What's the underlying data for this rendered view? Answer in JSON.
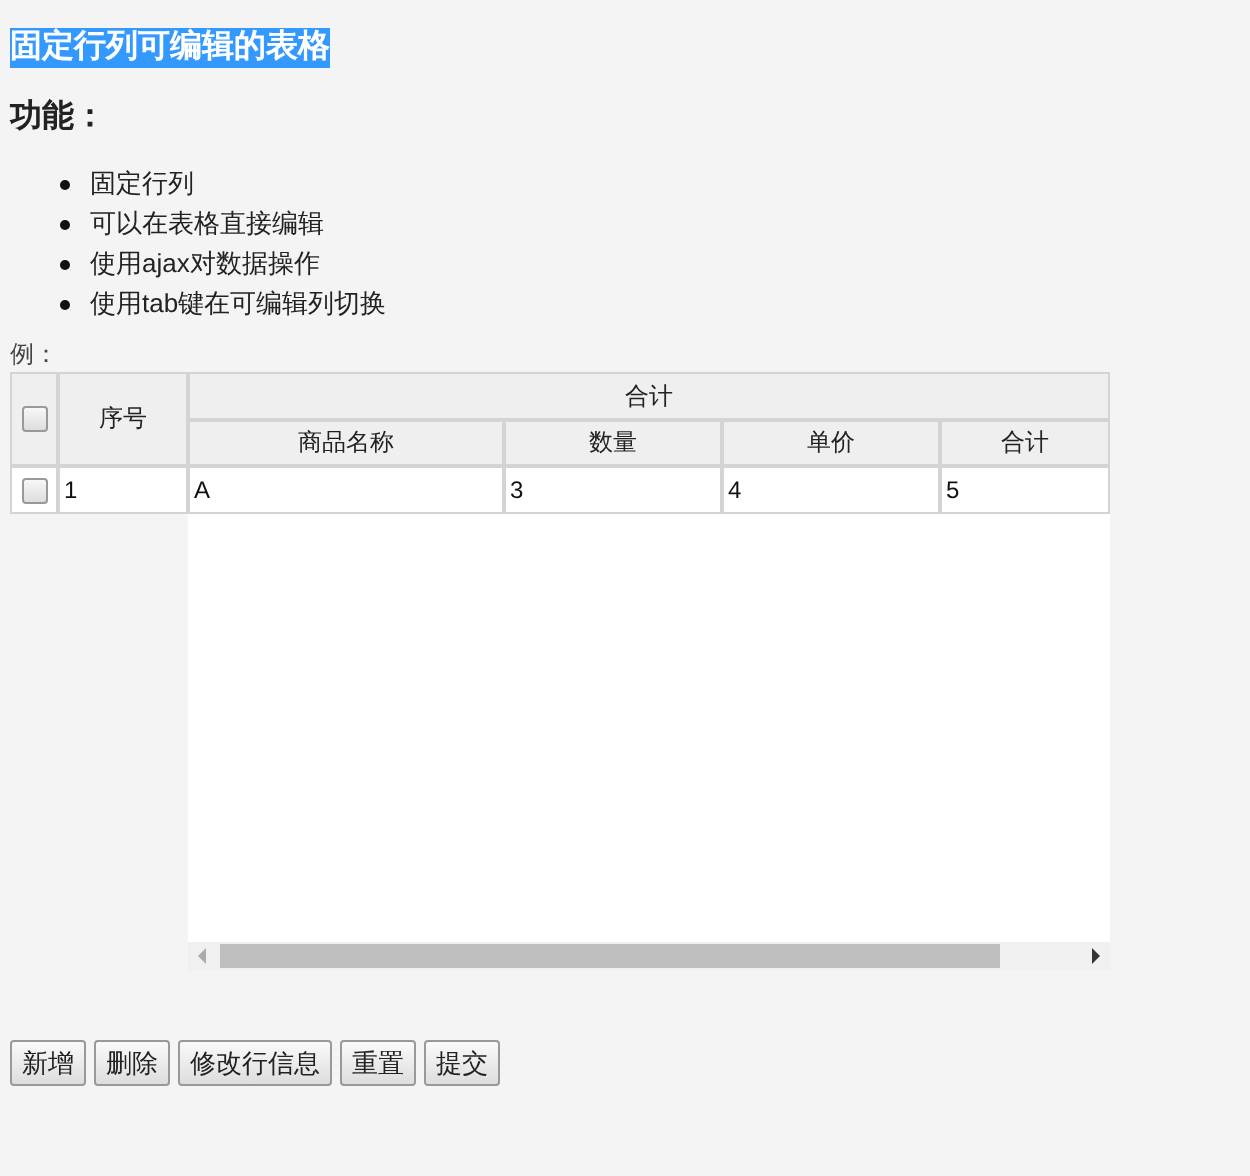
{
  "title": "固定行列可编辑的表格",
  "features_heading": "功能：",
  "features": [
    "固定行列",
    "可以在表格直接编辑",
    "使用ajax对数据操作",
    "使用tab键在可编辑列切换"
  ],
  "example_label": "例：",
  "table": {
    "header_checked": false,
    "frozen_columns": [
      "序号"
    ],
    "group_header": "合计",
    "columns": [
      "商品名称",
      "数量",
      "单价",
      "合计"
    ],
    "rows": [
      {
        "checked": false,
        "cells": [
          "1",
          "A",
          "3",
          "4",
          "5"
        ]
      }
    ]
  },
  "buttons": [
    "新增",
    "删除",
    "修改行信息",
    "重置",
    "提交"
  ]
}
